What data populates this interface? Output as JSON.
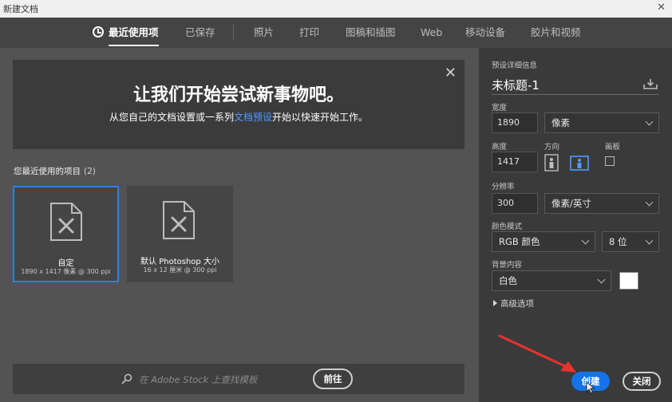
{
  "window": {
    "title": "新建文档",
    "close_glyph": "✕"
  },
  "tabs": [
    {
      "label": "最近使用项",
      "active": true
    },
    {
      "label": "已保存"
    },
    {
      "label": "照片"
    },
    {
      "label": "打印"
    },
    {
      "label": "图稿和插图"
    },
    {
      "label": "Web"
    },
    {
      "label": "移动设备"
    },
    {
      "label": "胶片和视频"
    }
  ],
  "banner": {
    "headline": "让我们开始尝试新事物吧。",
    "sub_before": "从您自己的文档设置或一系列",
    "sub_link": "文档预设",
    "sub_after": "开始以快速开始工作。",
    "close_glyph": "✕"
  },
  "recent": {
    "title": "您最近使用的项目",
    "count": "(2)",
    "items": [
      {
        "name": "自定",
        "meta": "1890 x 1417 像素 @ 300 ppi"
      },
      {
        "name": "默认 Photoshop 大小",
        "meta": "16 x 12 厘米 @ 300 ppi"
      }
    ]
  },
  "search": {
    "placeholder": "在 Adobe Stock 上查找模板",
    "go_label": "前往"
  },
  "preset": {
    "section_label": "预设详细信息",
    "doc_name": "未标题-1",
    "width_label": "宽度",
    "width_value": "1890",
    "width_unit": "像素",
    "height_label": "高度",
    "height_value": "1417",
    "orientation_label": "方向",
    "artboard_label": "画板",
    "resolution_label": "分辨率",
    "resolution_value": "300",
    "resolution_unit": "像素/英寸",
    "color_mode_label": "颜色模式",
    "color_mode": "RGB 颜色",
    "bit_depth": "8 位",
    "background_label": "背景内容",
    "background": "白色",
    "advanced_label": "高级选项"
  },
  "actions": {
    "create_label": "创建",
    "close_label": "关闭"
  },
  "colors": {
    "accent": "#1473e6",
    "link": "#4d9bff",
    "annotation_arrow": "#e8322f"
  }
}
